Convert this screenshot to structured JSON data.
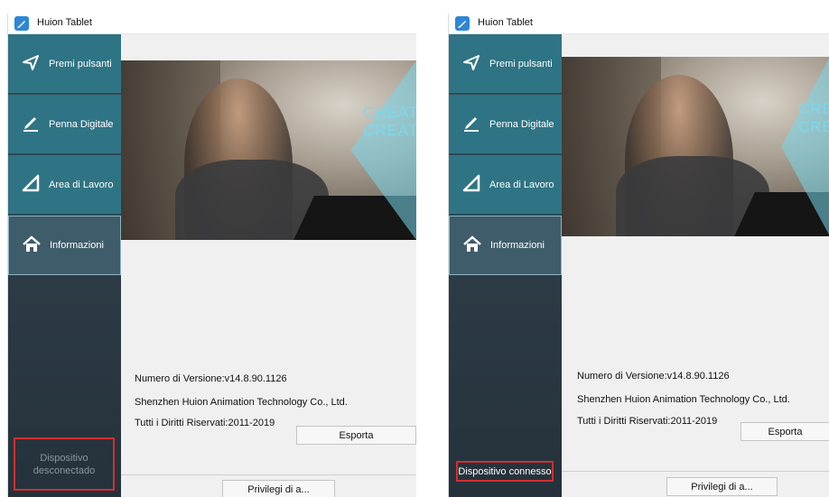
{
  "windows": [
    {
      "title": "Huion Tablet",
      "nav": [
        {
          "label": "Premi pulsanti",
          "icon": "send-icon"
        },
        {
          "label": "Penna Digitale",
          "icon": "pen-icon"
        },
        {
          "label": "Area di Lavoro",
          "icon": "triangle-icon"
        },
        {
          "label": "Informazioni",
          "icon": "home-icon"
        }
      ],
      "active_nav": "Informazioni",
      "banner": {
        "text_line1": "CREAT",
        "text_line2": "CREAT"
      },
      "info": {
        "version": "Numero di Versione:v14.8.90.1126",
        "company": "Shenzhen Huion Animation Technology Co., Ltd.",
        "rights": "Tutti i Diritti Riservati:2011-2019"
      },
      "export_button": "Esporta",
      "privileges_button": "Privilegi di a...",
      "device_status": "Dispositivo desconectado",
      "device_status_color": "#8a95a0"
    },
    {
      "title": "Huion Tablet",
      "nav": [
        {
          "label": "Premi pulsanti",
          "icon": "send-icon"
        },
        {
          "label": "Penna Digitale",
          "icon": "pen-icon"
        },
        {
          "label": "Area di Lavoro",
          "icon": "triangle-icon"
        },
        {
          "label": "Informazioni",
          "icon": "home-icon"
        }
      ],
      "active_nav": "Informazioni",
      "banner": {
        "text_line1": "CRE",
        "text_line2": "CRE"
      },
      "info": {
        "version": "Numero di Versione:v14.8.90.1126",
        "company": "Shenzhen Huion Animation Technology Co., Ltd.",
        "rights": "Tutti i Diritti Riservati:2011-2019"
      },
      "export_button": "Esporta",
      "privileges_button": "Privilegi di a...",
      "device_status": "Dispositivo connesso",
      "device_status_color": "#ffffff"
    }
  ],
  "colors": {
    "sidebar_item": "#2f7484",
    "sidebar_dark": "#2c3a45",
    "highlight_box": "#d32f2f",
    "banner_accent": "#7fd6ea"
  }
}
